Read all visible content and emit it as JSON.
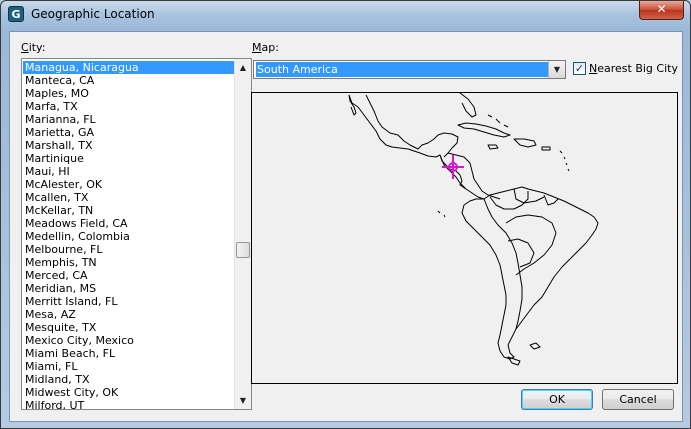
{
  "window": {
    "title": "Geographic Location",
    "close_glyph": "✕"
  },
  "city": {
    "label_accel": "C",
    "label_rest": "ity:",
    "items": [
      "Managua, Nicaragua",
      "Manteca, CA",
      "Maples, MO",
      "Marfa, TX",
      "Marianna, FL",
      "Marietta, GA",
      "Marshall, TX",
      "Martinique",
      "Maui, HI",
      "McAlester, OK",
      "Mcallen, TX",
      "McKellar, TN",
      "Meadows Field, CA",
      "Medellin, Colombia",
      "Melbourne, FL",
      "Memphis, TN",
      "Merced, CA",
      "Meridian, MS",
      "Merritt Island, FL",
      "Mesa, AZ",
      "Mesquite, TX",
      "Mexico City, Mexico",
      "Miami Beach, FL",
      "Miami, FL",
      "Midland, TX",
      "Midwest City, OK",
      "Milford, UT"
    ],
    "selected_index": 0
  },
  "map": {
    "label_accel": "M",
    "label_rest": "ap:",
    "selected": "South America",
    "marker_color": "#d01ad0"
  },
  "nearest": {
    "label_accel": "N",
    "label_rest": "earest Big City",
    "checked": true,
    "check_glyph": "✓"
  },
  "buttons": {
    "ok": "OK",
    "cancel": "Cancel"
  },
  "icons": {
    "app": "G",
    "up": "▲",
    "down": "▼"
  },
  "colors": {
    "selection": "#3399ff",
    "close": "#c74a31"
  }
}
